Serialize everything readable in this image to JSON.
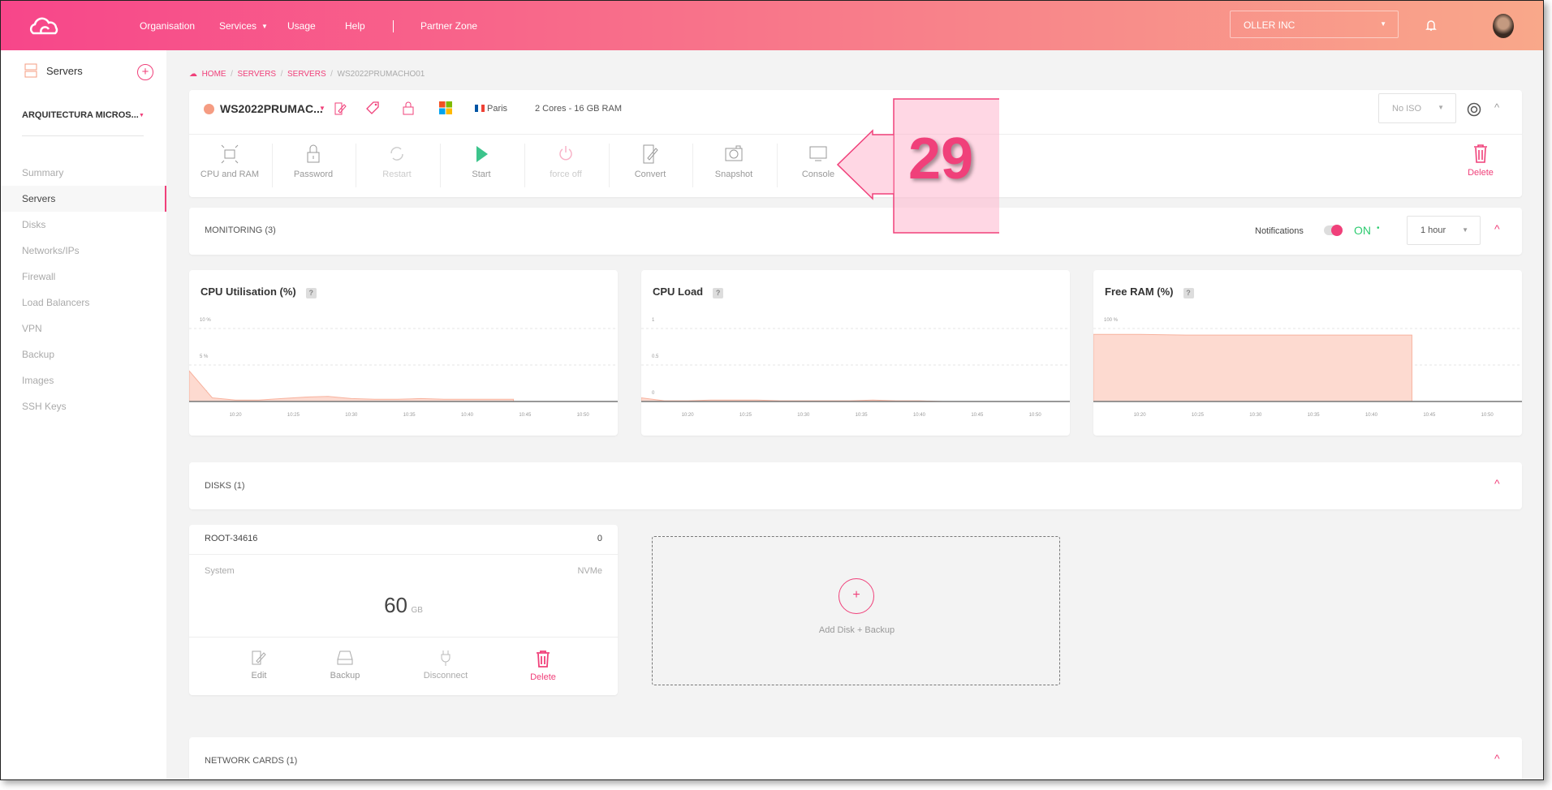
{
  "header": {
    "nav": [
      "Organisation",
      "Services",
      "Usage",
      "Help",
      "Partner Zone"
    ],
    "org_select": "OLLER INC"
  },
  "sidebar": {
    "title": "Servers",
    "project": "ARQUITECTURA MICROS...",
    "items": [
      "Summary",
      "Servers",
      "Disks",
      "Networks/IPs",
      "Firewall",
      "Load Balancers",
      "VPN",
      "Backup",
      "Images",
      "SSH Keys"
    ],
    "active": "Servers"
  },
  "breadcrumb": [
    "HOME",
    "SERVERS",
    "SERVERS",
    "WS2022PRUMACHO01"
  ],
  "server": {
    "name": "WS2022PRUMAC...",
    "location": "Paris",
    "specs": "2 Cores - 16 GB RAM",
    "iso": "No ISO",
    "status_color": "#f59c82",
    "actions": [
      {
        "label": "CPU and RAM",
        "enabled": true
      },
      {
        "label": "Password",
        "enabled": true
      },
      {
        "label": "Restart",
        "enabled": false
      },
      {
        "label": "Start",
        "enabled": true
      },
      {
        "label": "force off",
        "enabled": false
      },
      {
        "label": "Convert",
        "enabled": true
      },
      {
        "label": "Snapshot",
        "enabled": true
      },
      {
        "label": "Console",
        "enabled": true
      }
    ],
    "delete": "Delete"
  },
  "monitoring": {
    "title": "MONITORING (3)",
    "notifications": "Notifications",
    "toggle": "ON",
    "range": "1 hour"
  },
  "chart_data": [
    {
      "type": "area",
      "title": "CPU Utilisation (%)",
      "help": "?",
      "x": [
        "10:16",
        "10:18",
        "10:20",
        "10:22",
        "10:24",
        "10:26",
        "10:28",
        "10:30",
        "10:32",
        "10:34",
        "10:36",
        "10:38",
        "10:40",
        "10:42",
        "10:44"
      ],
      "values": [
        4.2,
        0.5,
        0.2,
        0.2,
        0.4,
        0.6,
        0.7,
        0.4,
        0.3,
        0.3,
        0.4,
        0.3,
        0.3,
        0.3,
        0.3
      ],
      "xticks": [
        "10:20",
        "10:25",
        "10:30",
        "10:35",
        "10:40",
        "10:45",
        "10:50"
      ],
      "yticks": [
        "0 %",
        "5 %",
        "10 %"
      ],
      "ylim": [
        0,
        10
      ],
      "xlim": [
        "10:16",
        "10:53"
      ]
    },
    {
      "type": "area",
      "title": "CPU Load",
      "help": "?",
      "x": [
        "10:16",
        "10:18",
        "10:20",
        "10:22",
        "10:24",
        "10:26",
        "10:28",
        "10:30",
        "10:32",
        "10:34",
        "10:36",
        "10:38",
        "10:40",
        "10:42",
        "10:44"
      ],
      "values": [
        0.05,
        0.01,
        0.01,
        0.02,
        0.02,
        0.02,
        0.01,
        0.01,
        0.01,
        0.01,
        0.02,
        0.01,
        0.01,
        0.0,
        0.0
      ],
      "xticks": [
        "10:20",
        "10:25",
        "10:30",
        "10:35",
        "10:40",
        "10:45",
        "10:50"
      ],
      "yticks": [
        "0",
        "0.5",
        "1"
      ],
      "ylim": [
        0,
        1
      ],
      "xlim": [
        "10:16",
        "10:53"
      ]
    },
    {
      "type": "area",
      "title": "Free RAM (%)",
      "help": "?",
      "x": [
        "10:16",
        "10:20",
        "10:24",
        "10:30",
        "10:36",
        "10:40",
        "10:43.5"
      ],
      "values": [
        92,
        92,
        91,
        91,
        91,
        91,
        91
      ],
      "xticks": [
        "10:20",
        "10:25",
        "10:30",
        "10:35",
        "10:40",
        "10:45",
        "10:50"
      ],
      "yticks": [
        "0 %",
        "50 %",
        "100 %"
      ],
      "ylim": [
        0,
        100
      ],
      "xlim": [
        "10:16",
        "10:53"
      ]
    }
  ],
  "disks": {
    "title": "DISKS (1)",
    "disk": {
      "name": "ROOT-34616",
      "index": "0",
      "type": "System",
      "storage": "NVMe",
      "size": "60",
      "unit": "GB",
      "actions": [
        "Edit",
        "Backup",
        "Disconnect",
        "Delete"
      ]
    },
    "add": "Add Disk + Backup"
  },
  "network": {
    "title": "NETWORK CARDS (1)"
  },
  "annotation": {
    "number": "29"
  },
  "colors": {
    "accent": "#f0407a",
    "chart_fill": "#fddad0",
    "chart_line": "#f7b29e",
    "on": "#2ecc71"
  }
}
